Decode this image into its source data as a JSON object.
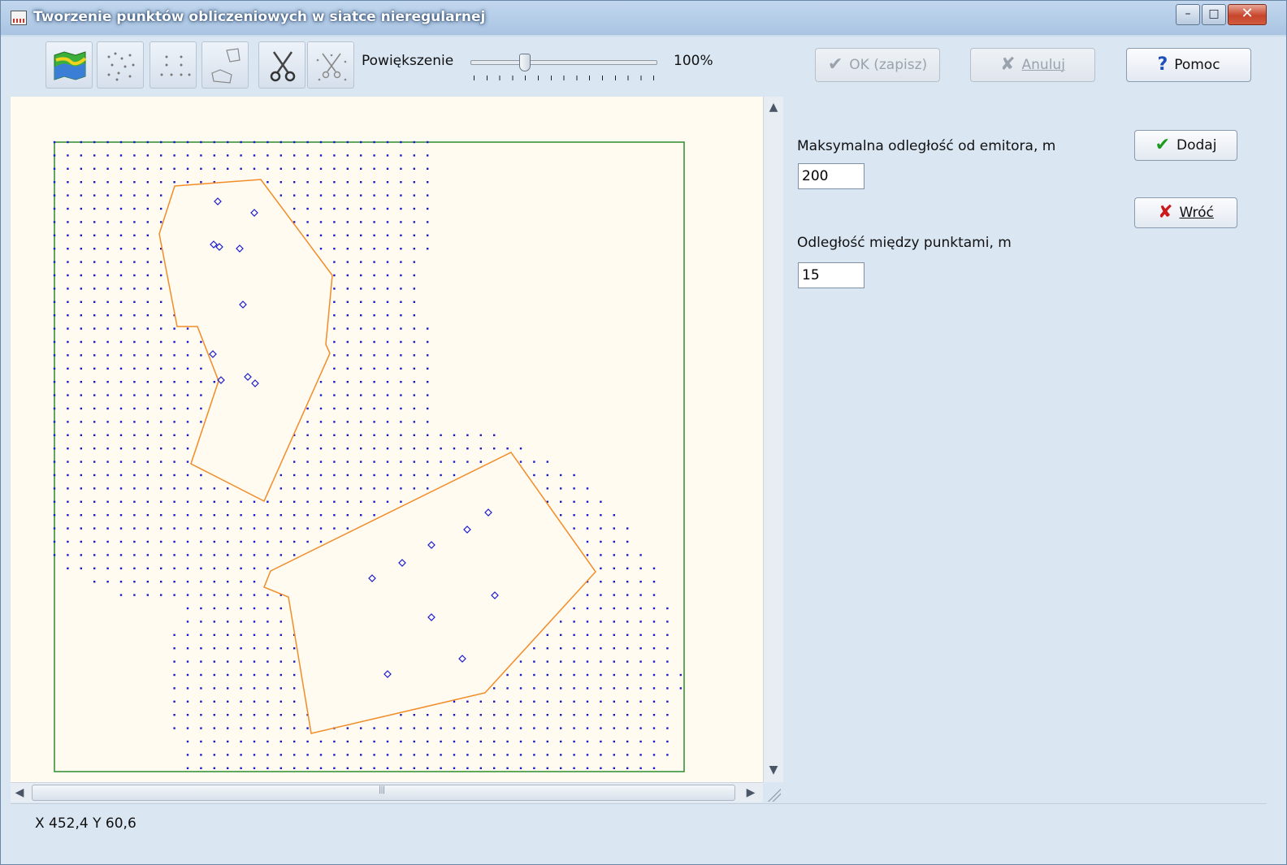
{
  "window": {
    "title": "Tworzenie punktów obliczeniowych w siatce nieregularnej",
    "controls": {
      "minimize": "–",
      "maximize": "□",
      "close": "✕"
    }
  },
  "toolbar": {
    "tools": [
      {
        "name": "map-tool",
        "icon": "map-flag-icon"
      },
      {
        "name": "scatter-points-tool",
        "icon": "scattered-points-icon"
      },
      {
        "name": "grid-points-tool",
        "icon": "grid-points-icon"
      },
      {
        "name": "area-select-tool",
        "icon": "polygons-icon"
      },
      {
        "name": "cut-tool",
        "icon": "scissors-icon"
      },
      {
        "name": "cut-points-tool",
        "icon": "scissors-points-icon"
      }
    ],
    "zoom_label": "Powiększenie",
    "zoom_value": "100%",
    "zoom_level_fraction": 0.28,
    "ok_label": "OK (zapisz)",
    "cancel_label": "Anuluj",
    "help_label": "Pomoc"
  },
  "panel": {
    "max_distance_label": "Maksymalna odległość od emitora, m",
    "max_distance_value": "200",
    "spacing_label": "Odległość między  punktami, m",
    "spacing_value": "15",
    "add_label": "Dodaj",
    "back_label": "Wróć"
  },
  "status": {
    "coordinates": "X 452,4 Y 60,6"
  },
  "colors": {
    "grid_points": "#1a1acc",
    "polygon": "#f28c28",
    "boundary": "#2e8b2e",
    "canvas": "#fffbf0"
  }
}
